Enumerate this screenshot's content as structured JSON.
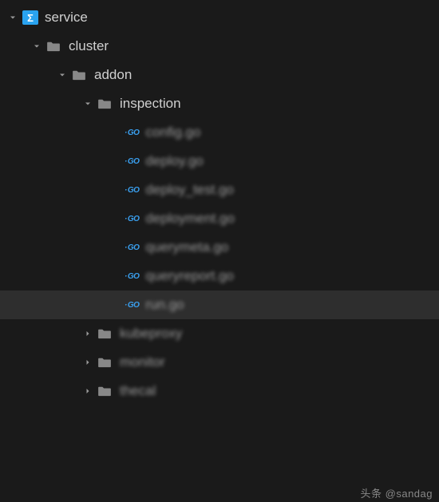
{
  "tree": {
    "root": {
      "label": "service",
      "expanded": true
    },
    "cluster": {
      "label": "cluster",
      "expanded": true
    },
    "addon": {
      "label": "addon",
      "expanded": true
    },
    "inspection": {
      "label": "inspection",
      "expanded": true
    },
    "files": [
      {
        "label": "config.go",
        "blurred": true
      },
      {
        "label": "deploy.go",
        "blurred": true
      },
      {
        "label": "deploy_test.go",
        "blurred": true
      },
      {
        "label": "deployment.go",
        "blurred": true
      },
      {
        "label": "querymeta.go",
        "blurred": true
      },
      {
        "label": "queryreport.go",
        "blurred": true
      },
      {
        "label": "run.go",
        "blurred": true,
        "selected": true
      }
    ],
    "collapsed": [
      {
        "label": "kubeproxy",
        "blurred": true
      },
      {
        "label": "monitor",
        "blurred": true
      },
      {
        "label": "thecal",
        "blurred": true
      }
    ]
  },
  "watermark": "头条 @sandag"
}
